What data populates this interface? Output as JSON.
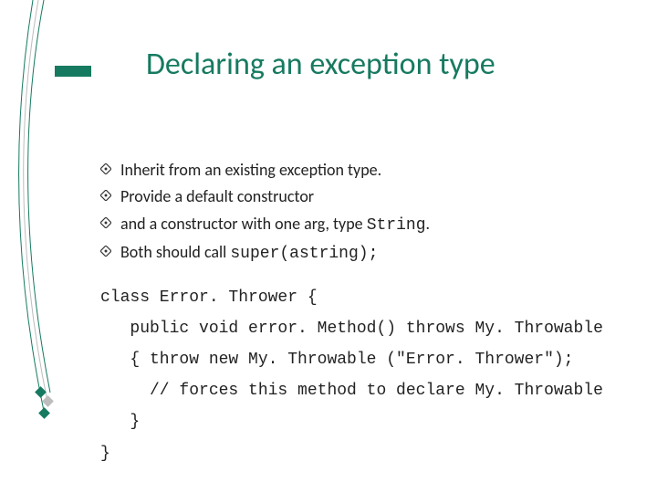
{
  "title": "Declaring an exception type",
  "bullets": [
    {
      "text": "Inherit from an existing exception type."
    },
    {
      "text_pre": "Provide a default constructor"
    },
    {
      "text_pre": "and a constructor with one arg, type ",
      "code": "String",
      "text_post": "."
    },
    {
      "text_pre": "Both should call ",
      "code": "super(astring);"
    }
  ],
  "code": {
    "l1": "class Error. Thrower {",
    "l2": "   public void error. Method() throws My. Throwable",
    "l3": "   { throw new My. Throwable (\"Error. Thrower\");",
    "l4": "     // forces this method to declare My. Throwable",
    "l5": "   }",
    "l6": "}"
  }
}
